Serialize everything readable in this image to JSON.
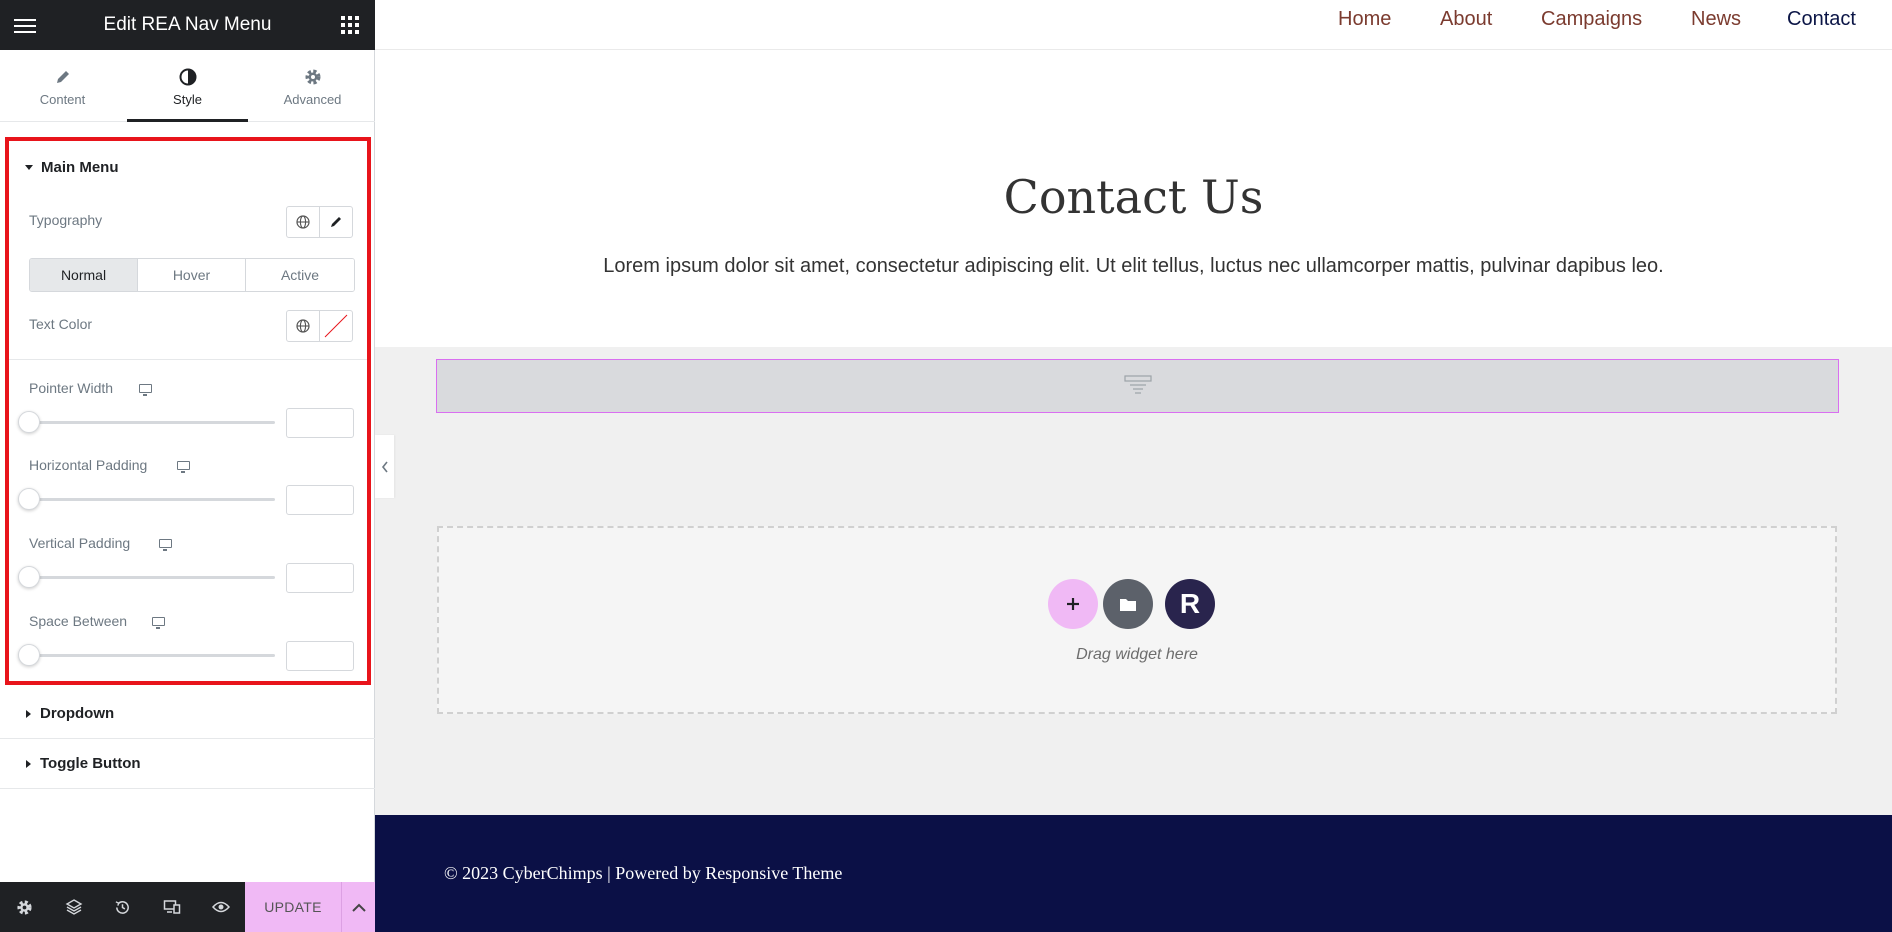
{
  "panel": {
    "title": "Edit REA Nav Menu",
    "tabs": [
      {
        "label": "Content",
        "icon": "pencil-icon"
      },
      {
        "label": "Style",
        "icon": "contrast-icon"
      },
      {
        "label": "Advanced",
        "icon": "gear-icon"
      }
    ],
    "active_tab": "Style",
    "main_menu": {
      "heading": "Main Menu",
      "typography_label": "Typography",
      "state_tabs": [
        "Normal",
        "Hover",
        "Active"
      ],
      "selected_state": "Normal",
      "text_color_label": "Text Color",
      "sliders": [
        {
          "label": "Pointer Width",
          "value": ""
        },
        {
          "label": "Horizontal Padding",
          "value": ""
        },
        {
          "label": "Vertical Padding",
          "value": ""
        },
        {
          "label": "Space Between",
          "value": ""
        }
      ]
    },
    "dropdown_heading": "Dropdown",
    "toggle_heading": "Toggle Button",
    "footer": {
      "update_label": "UPDATE",
      "icons": [
        "settings-icon",
        "layers-icon",
        "history-icon",
        "responsive-icon",
        "preview-eye-icon"
      ]
    }
  },
  "site": {
    "nav": [
      "Home",
      "About",
      "Campaigns",
      "News",
      "Contact"
    ],
    "current_nav": "Contact",
    "hero_title": "Contact Us",
    "hero_text": "Lorem ipsum dolor sit amet, consectetur adipiscing elit. Ut elit tellus, luctus nec ullamcorper mattis, pulvinar dapibus leo.",
    "drop_zone_text": "Drag widget here",
    "drop_zone_r": "R",
    "footer_text": "© 2023 CyberChimps | Powered by Responsive Theme"
  },
  "colors": {
    "accent_pink": "#f0b9f5",
    "highlight_red": "#e8141b",
    "nav_link": "#7b3b2f",
    "nav_current": "#0b1546",
    "footer_bg": "#0b1046"
  }
}
